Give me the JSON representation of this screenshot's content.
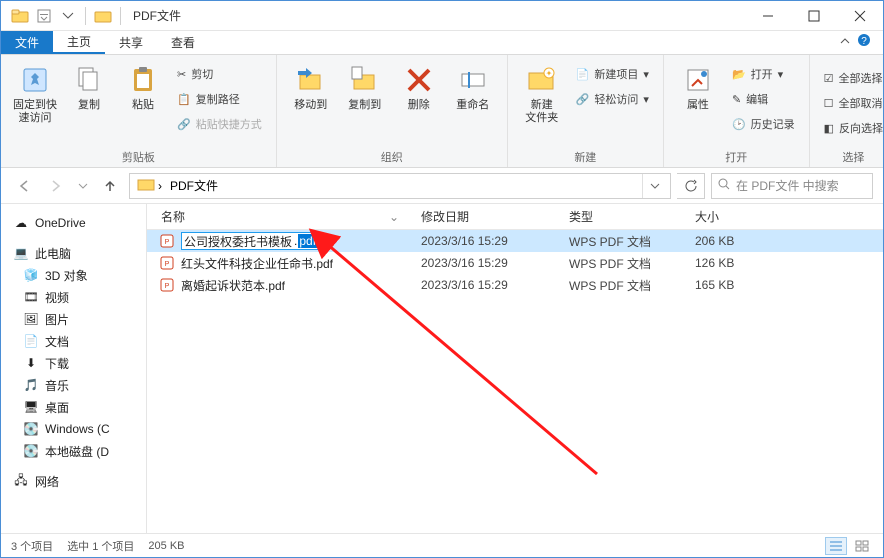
{
  "titlebar": {
    "title": "PDF文件"
  },
  "tabs": {
    "file": "文件",
    "home": "主页",
    "share": "共享",
    "view": "查看"
  },
  "ribbon": {
    "pin": {
      "label": "固定到快\n速访问"
    },
    "copy": "复制",
    "paste": "粘贴",
    "cut": "剪切",
    "copy_path": "复制路径",
    "paste_shortcut": "粘贴快捷方式",
    "group_clipboard": "剪贴板",
    "move_to": "移动到",
    "copy_to": "复制到",
    "delete": "删除",
    "rename": "重命名",
    "group_organize": "组织",
    "new_folder": "新建\n文件夹",
    "new_item": "新建项目",
    "easy_access": "轻松访问",
    "group_new": "新建",
    "properties": "属性",
    "open": "打开",
    "edit": "编辑",
    "history": "历史记录",
    "group_open": "打开",
    "select_all": "全部选择",
    "select_none": "全部取消",
    "invert": "反向选择",
    "group_select": "选择"
  },
  "address": {
    "path": "PDF文件",
    "search_placeholder": "在 PDF文件 中搜索"
  },
  "sidebar": {
    "onedrive": "OneDrive",
    "this_pc": "此电脑",
    "objects_3d": "3D 对象",
    "videos": "视频",
    "pictures": "图片",
    "documents": "文档",
    "downloads": "下载",
    "music": "音乐",
    "desktop": "桌面",
    "windows_c": "Windows (C",
    "local_disk_d": "本地磁盘 (D",
    "network": "网络"
  },
  "columns": {
    "name": "名称",
    "date": "修改日期",
    "type": "类型",
    "size": "大小"
  },
  "files": [
    {
      "name_base": "公司授权委托书模板",
      "name_ext": ".pdf",
      "date": "2023/3/16 15:29",
      "type": "WPS PDF 文档",
      "size": "206 KB",
      "renaming": true,
      "selected": true
    },
    {
      "name_base": "红头文件科技企业任命书",
      "name_ext": ".pdf",
      "date": "2023/3/16 15:29",
      "type": "WPS PDF 文档",
      "size": "126 KB",
      "renaming": false,
      "selected": false
    },
    {
      "name_base": "离婚起诉状范本",
      "name_ext": ".pdf",
      "date": "2023/3/16 15:29",
      "type": "WPS PDF 文档",
      "size": "165 KB",
      "renaming": false,
      "selected": false
    }
  ],
  "status": {
    "items": "3 个项目",
    "selected": "选中 1 个项目",
    "size": "205 KB"
  }
}
